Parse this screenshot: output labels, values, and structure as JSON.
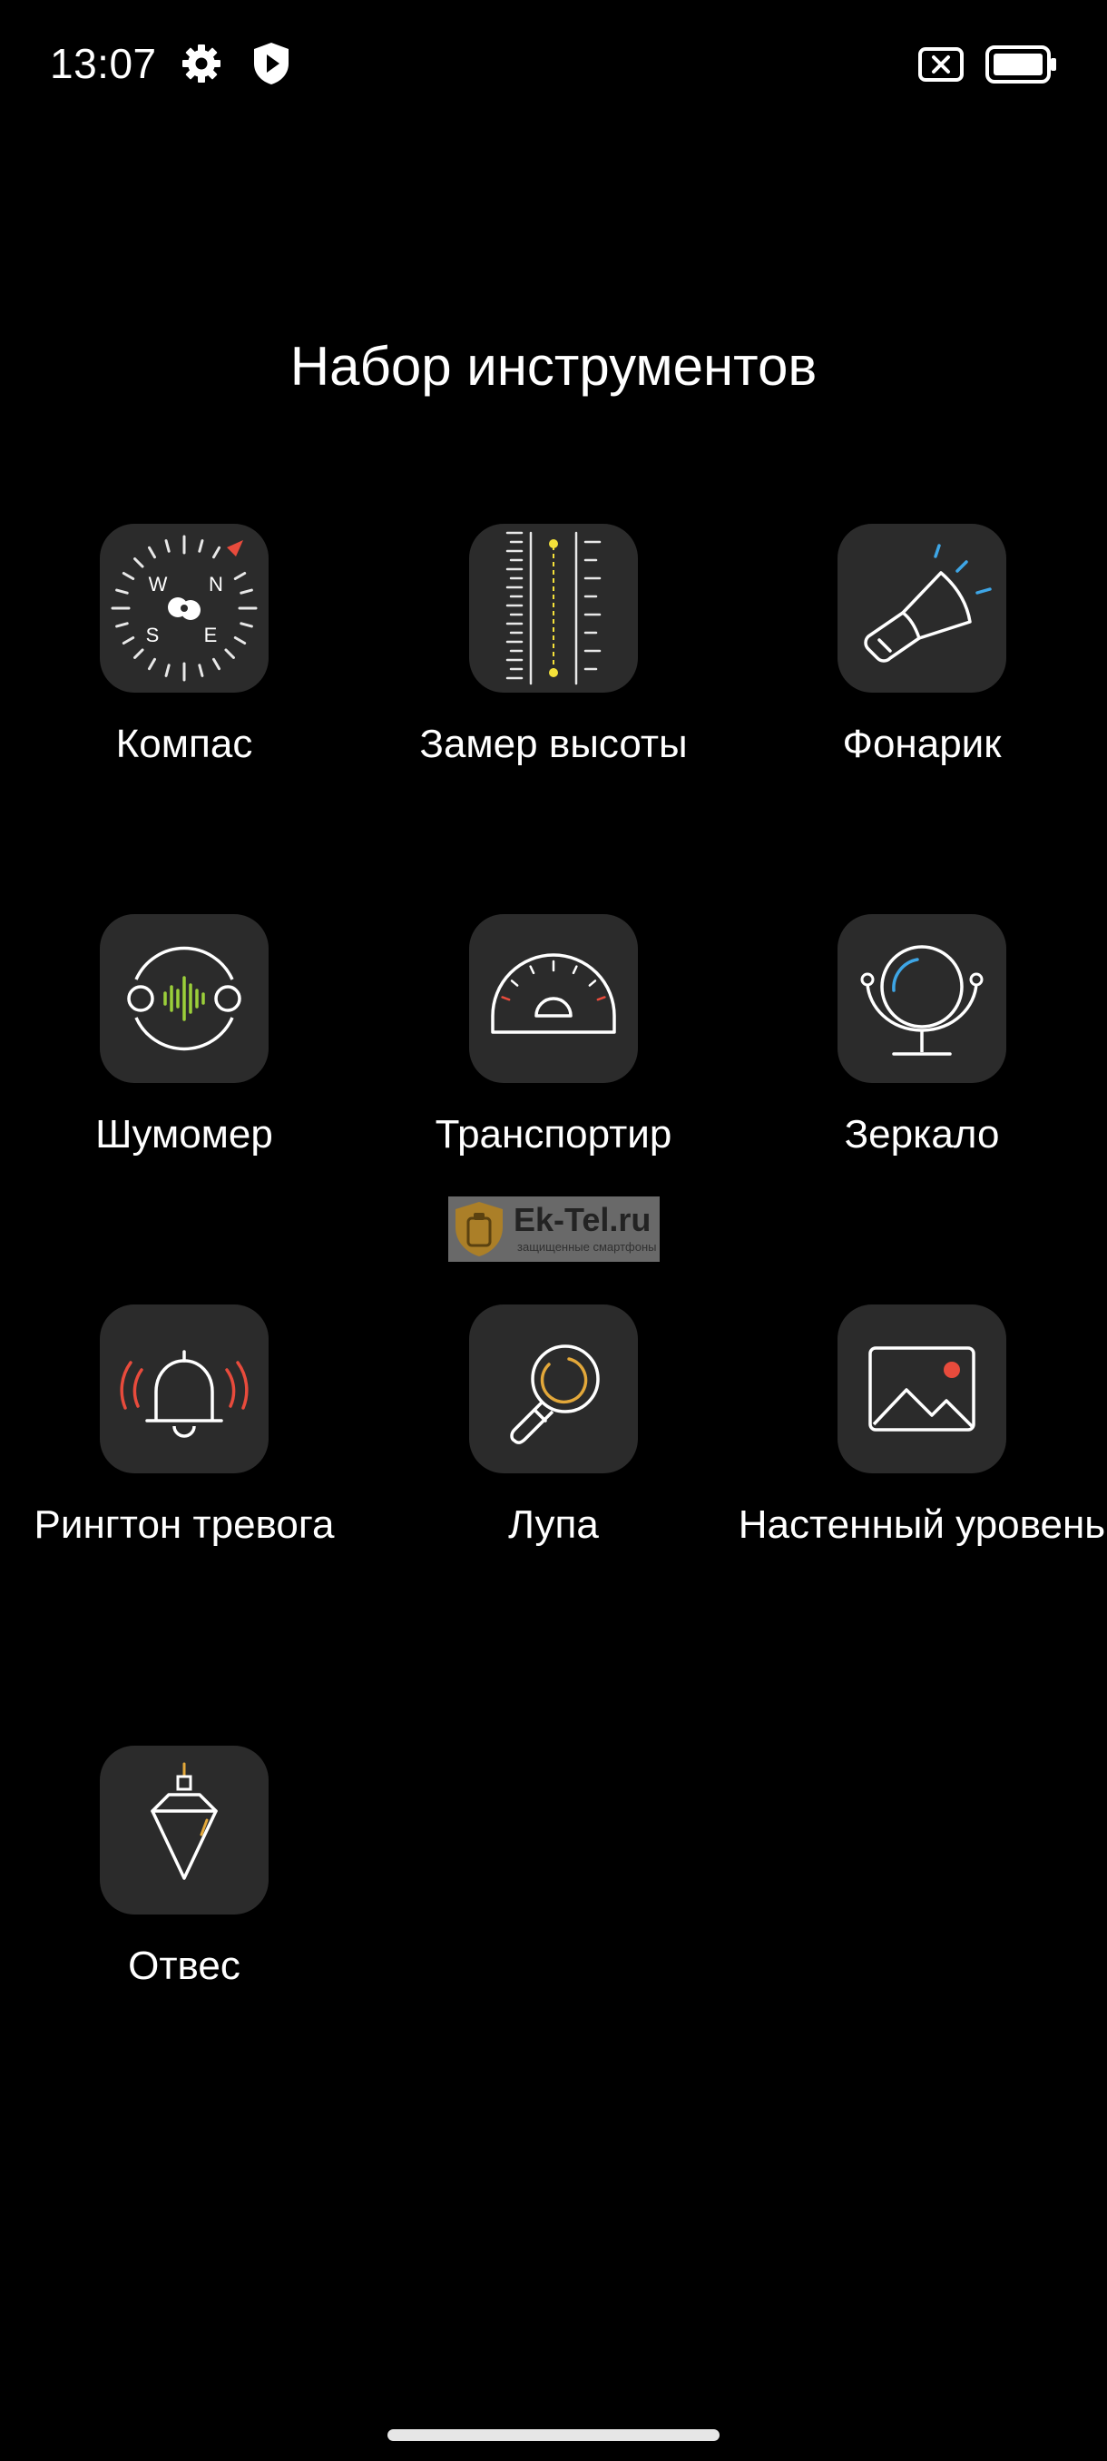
{
  "status_bar": {
    "time": "13:07",
    "left_icons": [
      "gear-icon",
      "shield-play-icon"
    ],
    "right_icons": [
      "sim-disabled-icon",
      "battery-icon"
    ]
  },
  "page": {
    "title": "Набор инструментов"
  },
  "tools": [
    {
      "label": "Компас",
      "icon": "compass-icon"
    },
    {
      "label": "Замер высоты",
      "icon": "height-ruler-icon"
    },
    {
      "label": "Фонарик",
      "icon": "flashlight-icon"
    },
    {
      "label": "Шумомер",
      "icon": "sound-meter-icon"
    },
    {
      "label": "Транспортир",
      "icon": "protractor-icon"
    },
    {
      "label": "Зеркало",
      "icon": "mirror-icon"
    },
    {
      "label": "Рингтон тревога",
      "icon": "alarm-bell-icon"
    },
    {
      "label": "Лупа",
      "icon": "magnifier-icon"
    },
    {
      "label": "Настенный уровень",
      "icon": "picture-frame-icon"
    },
    {
      "label": "Отвес",
      "icon": "plumb-bob-icon"
    }
  ],
  "compass_letters": {
    "n": "N",
    "w": "W",
    "s": "S",
    "e": "E"
  },
  "watermark": {
    "title": "Ek-Tel.ru",
    "subtitle": "защищенные смартфоны"
  },
  "colors": {
    "background": "#000000",
    "tile": "#2b2b2b",
    "accent_yellow": "#f4e13a",
    "accent_red": "#e84b3c",
    "accent_blue": "#3ea6e6",
    "accent_green": "#9bcf3a",
    "accent_orange": "#e3a83a"
  }
}
